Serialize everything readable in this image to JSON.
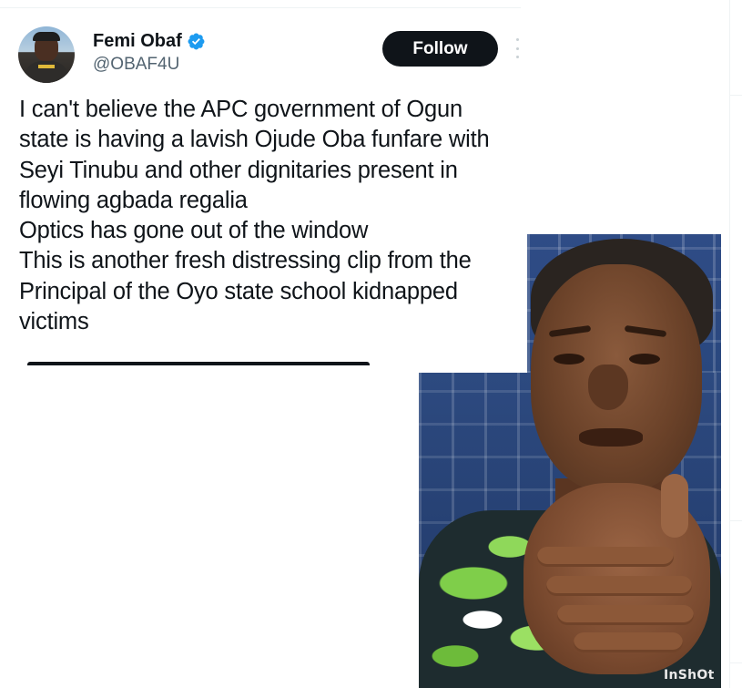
{
  "tweet": {
    "author": {
      "display_name": "Femi Obaf",
      "handle": "@OBAF4U",
      "verified": true,
      "avatar_icon": "user-avatar"
    },
    "follow_label": "Follow",
    "more_icon": "more-options-icon",
    "text_lines": [
      "I can't believe the APC government of Ogun",
      "state is having a lavish Ojude Oba funfare with",
      "Seyi Tinubu and other dignitaries present in",
      "flowing agbada regalia",
      "Optics has gone out of the window",
      "This is another fresh distressing clip from the",
      "Principal of the Oyo state school kidnapped",
      "victims"
    ]
  },
  "video_still": {
    "watermark": "InShOt"
  },
  "colors": {
    "text_primary": "#0f1419",
    "text_secondary": "#536471",
    "follow_bg": "#0f1419",
    "verified_blue": "#1d9bf0",
    "divider": "#eff3f4"
  }
}
